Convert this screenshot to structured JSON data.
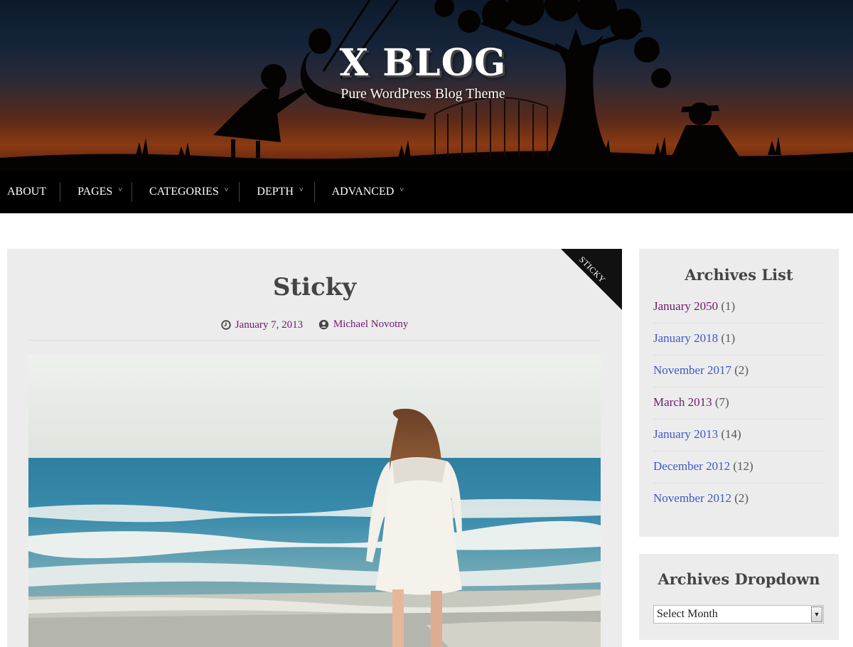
{
  "site": {
    "title": "X BLOG",
    "tagline": "Pure WordPress Blog Theme"
  },
  "nav": {
    "items": [
      {
        "label": "ABOUT",
        "has_submenu": false
      },
      {
        "label": "PAGES",
        "has_submenu": true
      },
      {
        "label": "CATEGORIES",
        "has_submenu": true
      },
      {
        "label": "DEPTH",
        "has_submenu": true
      },
      {
        "label": "ADVANCED",
        "has_submenu": true
      }
    ],
    "chevron": "˅"
  },
  "post": {
    "title": "Sticky",
    "badge": "STICKY",
    "date": "January 7, 2013",
    "author": "Michael Novotny",
    "icons": {
      "date": "clock-icon",
      "author": "user-icon"
    }
  },
  "sidebar": {
    "archives_list": {
      "title": "Archives List",
      "items": [
        {
          "month": "January 2050",
          "count": "(1)",
          "visited": true
        },
        {
          "month": "January 2018",
          "count": "(1)",
          "visited": false
        },
        {
          "month": "November 2017",
          "count": "(2)",
          "visited": false
        },
        {
          "month": "March 2013",
          "count": "(7)",
          "visited": true
        },
        {
          "month": "January 2013",
          "count": "(14)",
          "visited": false
        },
        {
          "month": "December 2012",
          "count": "(12)",
          "visited": false
        },
        {
          "month": "November 2012",
          "count": "(2)",
          "visited": false
        }
      ]
    },
    "archives_dropdown": {
      "title": "Archives Dropdown",
      "selected": "Select Month"
    }
  },
  "colors": {
    "link": "#3f57c6",
    "link_visited": "#6a1b6a",
    "nav_bg": "#000000",
    "card_bg": "#ececec"
  }
}
